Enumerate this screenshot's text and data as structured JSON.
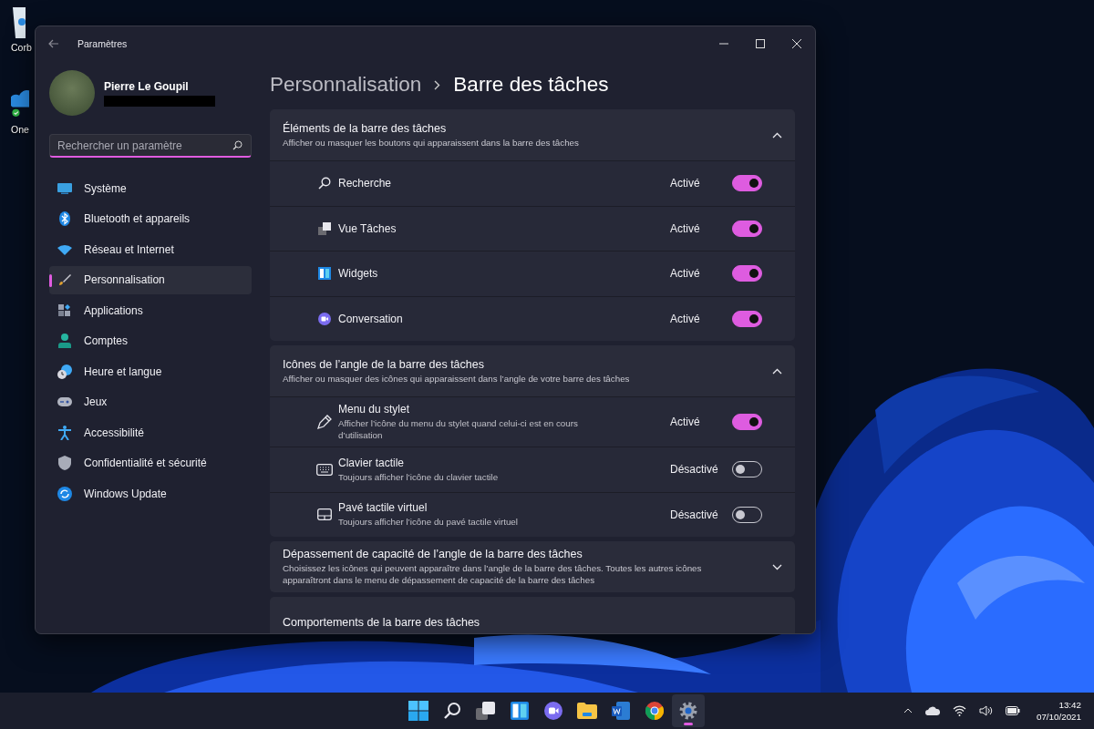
{
  "desktop_icons": [
    {
      "label": "Corb",
      "kind": "bin"
    },
    {
      "label": "One",
      "kind": "cloud"
    }
  ],
  "window": {
    "title": "Paramètres"
  },
  "user": {
    "name": "Pierre Le Goupil"
  },
  "search": {
    "placeholder": "Rechercher un paramètre"
  },
  "sidebar": {
    "items": [
      {
        "label": "Système",
        "kind": "system",
        "selected": false
      },
      {
        "label": "Bluetooth et appareils",
        "kind": "bluetooth",
        "selected": false
      },
      {
        "label": "Réseau et Internet",
        "kind": "network",
        "selected": false
      },
      {
        "label": "Personnalisation",
        "kind": "brush",
        "selected": true
      },
      {
        "label": "Applications",
        "kind": "apps",
        "selected": false
      },
      {
        "label": "Comptes",
        "kind": "account",
        "selected": false
      },
      {
        "label": "Heure et langue",
        "kind": "time",
        "selected": false
      },
      {
        "label": "Jeux",
        "kind": "gaming",
        "selected": false
      },
      {
        "label": "Accessibilité",
        "kind": "accessibility",
        "selected": false
      },
      {
        "label": "Confidentialité et sécurité",
        "kind": "shield",
        "selected": false
      },
      {
        "label": "Windows Update",
        "kind": "update",
        "selected": false
      }
    ]
  },
  "breadcrumb": [
    "Personnalisation",
    "Barre des tâches"
  ],
  "sections": [
    {
      "title": "Éléments de la barre des tâches",
      "subtitle": "Afficher ou masquer les boutons qui apparaissent dans la barre des tâches",
      "expanded": true,
      "rows": [
        {
          "kind": "search",
          "label": "Recherche",
          "status": "Activé",
          "on": true
        },
        {
          "kind": "taskview",
          "label": "Vue Tâches",
          "status": "Activé",
          "on": true
        },
        {
          "kind": "widgets",
          "label": "Widgets",
          "status": "Activé",
          "on": true
        },
        {
          "kind": "chat",
          "label": "Conversation",
          "status": "Activé",
          "on": true
        }
      ]
    },
    {
      "title": "Icônes de l’angle de la barre des tâches",
      "subtitle": "Afficher ou masquer des icônes qui apparaissent dans l’angle de votre barre des tâches",
      "expanded": true,
      "rows": [
        {
          "kind": "pen",
          "label": "Menu du stylet",
          "description": "Afficher l’icône du menu du stylet quand celui-ci est en cours d’utilisation",
          "status": "Activé",
          "on": true
        },
        {
          "kind": "keyboard",
          "label": "Clavier tactile",
          "description": "Toujours afficher l’icône du clavier tactile",
          "status": "Désactivé",
          "on": false
        },
        {
          "kind": "touchpad",
          "label": "Pavé tactile virtuel",
          "description": "Toujours afficher l’icône du pavé tactile virtuel",
          "status": "Désactivé",
          "on": false
        }
      ]
    },
    {
      "title": "Dépassement de capacité de l’angle de la barre des tâches",
      "subtitle": "Choisissez les icônes qui peuvent apparaître dans l’angle de la barre des tâches. Toutes les autres icônes apparaîtront dans le menu de dépassement de capacité de la barre des tâches",
      "expanded": false
    },
    {
      "title": "Comportements de la barre des tâches"
    }
  ],
  "taskbar": {
    "apps": [
      {
        "kind": "start",
        "selected": false
      },
      {
        "kind": "search",
        "selected": false
      },
      {
        "kind": "taskview",
        "selected": false
      },
      {
        "kind": "widgets",
        "selected": false
      },
      {
        "kind": "chat",
        "selected": false
      },
      {
        "kind": "folder",
        "selected": false
      },
      {
        "kind": "word",
        "selected": false
      },
      {
        "kind": "browser",
        "selected": false
      },
      {
        "kind": "settings",
        "selected": true
      }
    ],
    "time": "13:42",
    "date": "07/10/2021"
  }
}
